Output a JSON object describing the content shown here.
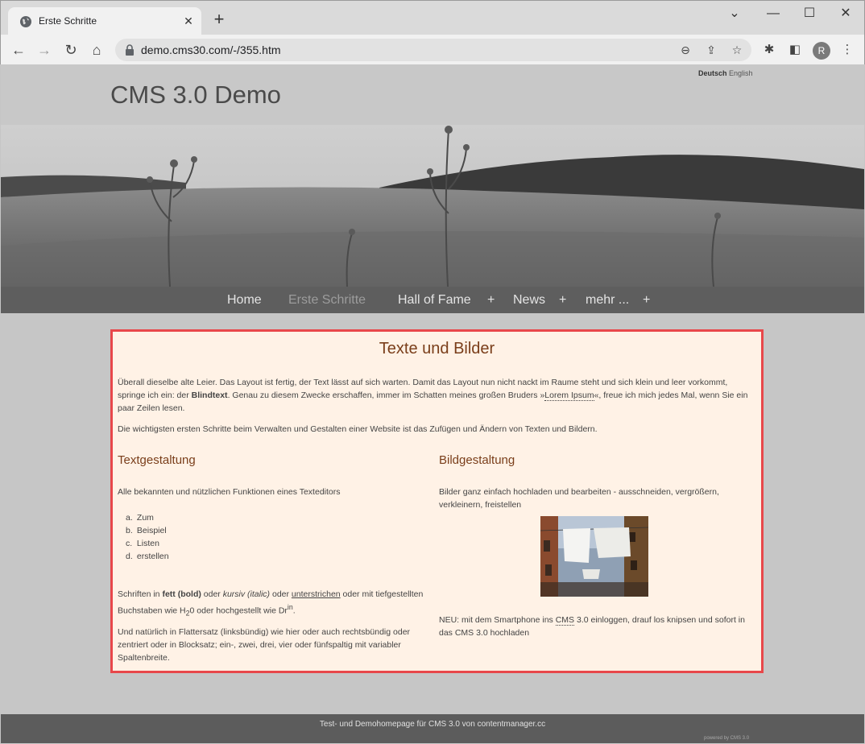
{
  "browser": {
    "tab_title": "Erste Schritte",
    "url": "demo.cms30.com/-/355.htm",
    "avatar_letter": "R"
  },
  "site": {
    "title": "CMS 3.0 Demo",
    "lang_de": "Deutsch",
    "lang_en": "English"
  },
  "nav": {
    "home": "Home",
    "erste": "Erste Schritte",
    "hall": "Hall of Fame",
    "news": "News",
    "mehr": "mehr ...",
    "plus": "+"
  },
  "content": {
    "heading": "Texte und Bilder",
    "p1_a": "Überall dieselbe alte Leier. Das Layout ist fertig, der Text lässt auf sich warten. Damit das Layout nun nicht nackt im Raume steht und sich klein und leer vorkommt, springe ich ein: der ",
    "p1_bold": "Blindtext",
    "p1_b": ". Genau zu diesem Zwecke erschaffen, immer im Schatten meines großen Bruders »",
    "p1_link": "Lorem Ipsum",
    "p1_c": "«, freue ich mich jedes Mal, wenn Sie ein paar Zeilen lesen.",
    "p2": "Die wichtigsten ersten Schritte beim Verwalten und Gestalten einer Website ist das Zufügen und Ändern von Texten und Bildern.",
    "left": {
      "heading": "Textgestaltung",
      "intro": "Alle bekannten und nützlichen Funktionen eines Texteditors",
      "list": [
        {
          "marker": "a.",
          "text": "Zum"
        },
        {
          "marker": "b.",
          "text": "Beispiel"
        },
        {
          "marker": "c.",
          "text": "Listen"
        },
        {
          "marker": "d.",
          "text": "erstellen"
        }
      ],
      "fonts_a": "Schriften in ",
      "fonts_bold": "fett (bold)",
      "fonts_b": " oder ",
      "fonts_italic": "kursiv (italic)",
      "fonts_c": " oder ",
      "fonts_underline": "unterstrichen",
      "fonts_d": " oder mit tiefgestellten Buchstaben wie H",
      "fonts_sub": "2",
      "fonts_e": "0 oder hochgestellt wie Dr",
      "fonts_sup": "in",
      "fonts_f": ".",
      "flatter": "Und natürlich in Flattersatz (linksbündig) wie hier oder auch rechtsbündig oder zentriert oder in Blocksatz; ein-, zwei, drei, vier oder fünfspaltig mit variabler Spaltenbreite."
    },
    "right": {
      "heading": "Bildgestaltung",
      "intro": "Bilder ganz einfach hochladen und bearbeiten - ausschneiden, vergrößern, verkleinern, freistellen",
      "neu_a": "NEU: mit dem Smartphone ins ",
      "neu_link": "CMS",
      "neu_b": " 3.0 einloggen, drauf los knipsen und sofort in das CMS 3.0 hochladen"
    }
  },
  "footer": {
    "text": "Test- und Demohomepage für CMS 3.0 von contentmanager.cc",
    "powered": "powered by CMS 3.0"
  }
}
